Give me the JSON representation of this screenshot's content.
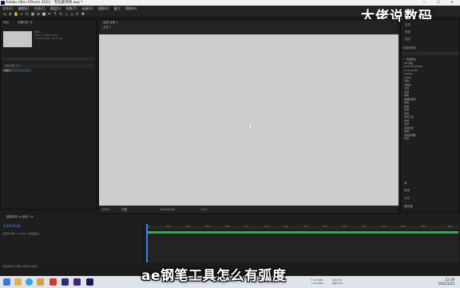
{
  "window": {
    "title": "Adobe After Effects 2022 - 无标题项目.aep *",
    "controls": "— ☐ ✕"
  },
  "menu": [
    "文件(F)",
    "编辑(E)",
    "合成(C)",
    "图层(L)",
    "效果(T)",
    "动画(A)",
    "视图(V)",
    "窗口",
    "帮助(H)"
  ],
  "watermark": "大佬说数码",
  "project_panel": {
    "tab": "项目",
    "tab2": "效果控件 无",
    "thumb_info": [
      "合成 1",
      "1920 x 1080 (1.00)",
      "Δ 0;00;30;00, 29.97 fps"
    ],
    "columns": "名称    类型    大小",
    "item": "合成 1"
  },
  "comp_panel": {
    "tab": "合成 合成 1",
    "subtab": "合成 1",
    "zoom": "100%",
    "quality": "完整",
    "timecode": "0;00;00;00",
    "extra": "+0.0"
  },
  "right_panel": {
    "items": [
      "信息",
      "音频",
      "预览"
    ],
    "effects_title": "效果和预设",
    "effects": [
      "* 动画预设",
      "3D 通道",
      "Boris FX Mocha",
      "Cinema 4D",
      "Keying",
      "Matte",
      "音频",
      "风格化",
      "过渡",
      "过时",
      "抠像",
      "模糊和锐化",
      "模拟",
      "扭曲",
      "生成",
      "时间",
      "实用工具",
      "透视",
      "文本",
      "颜色校正",
      "音频",
      "杂色和颗粒",
      "遮罩"
    ],
    "bottom_items": [
      "库",
      "段落",
      "字符",
      "跟踪器"
    ]
  },
  "timeline": {
    "tabs": "渲染队列    ≡ 合成 1 ≡",
    "timecode": "0;00;00;00",
    "columns": "源名称    模式    T TrkMat    父级和链接",
    "ruler": [
      "0s",
      "02s",
      "04s",
      "06s",
      "08s",
      "10s",
      "12s",
      "14s",
      "16s",
      "18s",
      "20s",
      "22s",
      "24s",
      "26s",
      "28s",
      "30s"
    ],
    "bottom": "帧渲染时间  0毫秒      切换开关/模式"
  },
  "taskbar": {
    "net": [
      "↑ 0.0 KB/s",
      "↓ 0.0 KB/s"
    ],
    "cpu": [
      "CPU 4%",
      "内存 47%"
    ],
    "time": "12:19",
    "date": "2022/1/22"
  },
  "caption": "ae钢笔工具怎么有弧度"
}
